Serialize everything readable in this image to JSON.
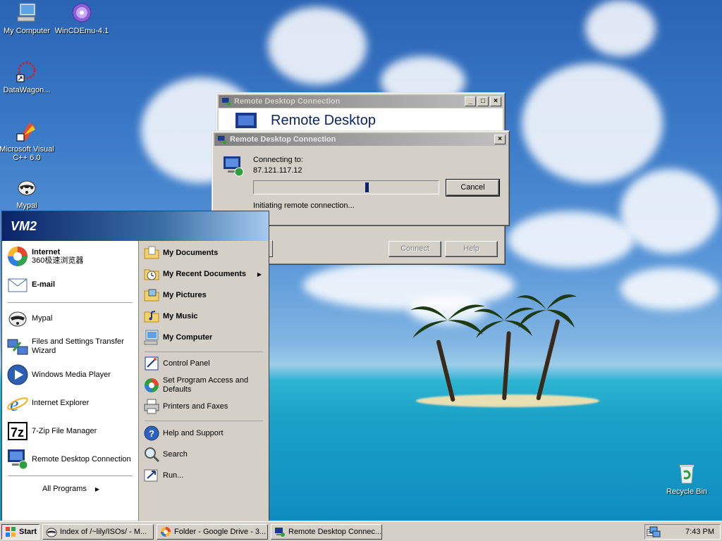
{
  "desktop": {
    "icons": [
      {
        "label": "My Computer",
        "icon": "computer-icon"
      },
      {
        "label": "WinCDEmu-4.1",
        "icon": "disc-icon"
      },
      {
        "label": "DataWagon...",
        "icon": "datawagon-icon"
      },
      {
        "label": "Microsoft Visual C++ 6.0",
        "icon": "visual-cpp-icon"
      },
      {
        "label": "Mypal",
        "icon": "raccoon-icon"
      },
      {
        "label": "Recycle Bin",
        "icon": "recycle-bin-icon"
      }
    ]
  },
  "rdc_main": {
    "title": "Remote Desktop Connection",
    "banner": "Remote Desktop",
    "connect_label": "Connect",
    "help_label": "Help"
  },
  "rdc_dialog": {
    "title": "Remote Desktop Connection",
    "connecting_to": "Connecting to:",
    "address": "87.121.117.12",
    "status": "Initiating remote connection...",
    "cancel_label": "Cancel"
  },
  "start_menu": {
    "user": "VM2",
    "pinned": [
      {
        "label": "Internet",
        "sublabel": "360极速浏览器",
        "icon": "browser-360-icon"
      },
      {
        "label": "E-mail",
        "icon": "mail-icon"
      }
    ],
    "recent": [
      {
        "label": "Mypal",
        "icon": "raccoon-icon"
      },
      {
        "label": "Files and Settings Transfer Wizard",
        "icon": "transfer-wizard-icon"
      },
      {
        "label": "Windows Media Player",
        "icon": "media-player-icon"
      },
      {
        "label": "Internet Explorer",
        "icon": "ie-icon"
      },
      {
        "label": "7-Zip File Manager",
        "icon": "7zip-icon"
      },
      {
        "label": "Remote Desktop Connection",
        "icon": "remote-desktop-icon"
      }
    ],
    "all_programs": "All Programs",
    "right_top": [
      {
        "label": "My Documents",
        "icon": "folder-docs-icon"
      },
      {
        "label": "My Recent Documents",
        "icon": "recent-docs-icon"
      },
      {
        "label": "My Pictures",
        "icon": "folder-pictures-icon"
      },
      {
        "label": "My Music",
        "icon": "folder-music-icon"
      },
      {
        "label": "My Computer",
        "icon": "computer-icon"
      }
    ],
    "right_mid": [
      {
        "label": "Control Panel",
        "icon": "control-panel-icon"
      },
      {
        "label": "Set Program Access and Defaults",
        "icon": "program-access-icon"
      },
      {
        "label": "Printers and Faxes",
        "icon": "printer-icon"
      }
    ],
    "right_bottom": [
      {
        "label": "Help and Support",
        "icon": "help-icon"
      },
      {
        "label": "Search",
        "icon": "search-icon"
      },
      {
        "label": "Run...",
        "icon": "run-icon"
      }
    ]
  },
  "taskbar": {
    "start_label": "Start",
    "buttons": [
      {
        "label": "Index of /~lily/ISOs/ - M...",
        "icon": "mypal-tab-icon"
      },
      {
        "label": "Folder - Google Drive - 3...",
        "icon": "browser-360-icon"
      },
      {
        "label": "Remote Desktop Connec...",
        "icon": "remote-desktop-icon"
      }
    ],
    "clock": "7:43 PM"
  }
}
